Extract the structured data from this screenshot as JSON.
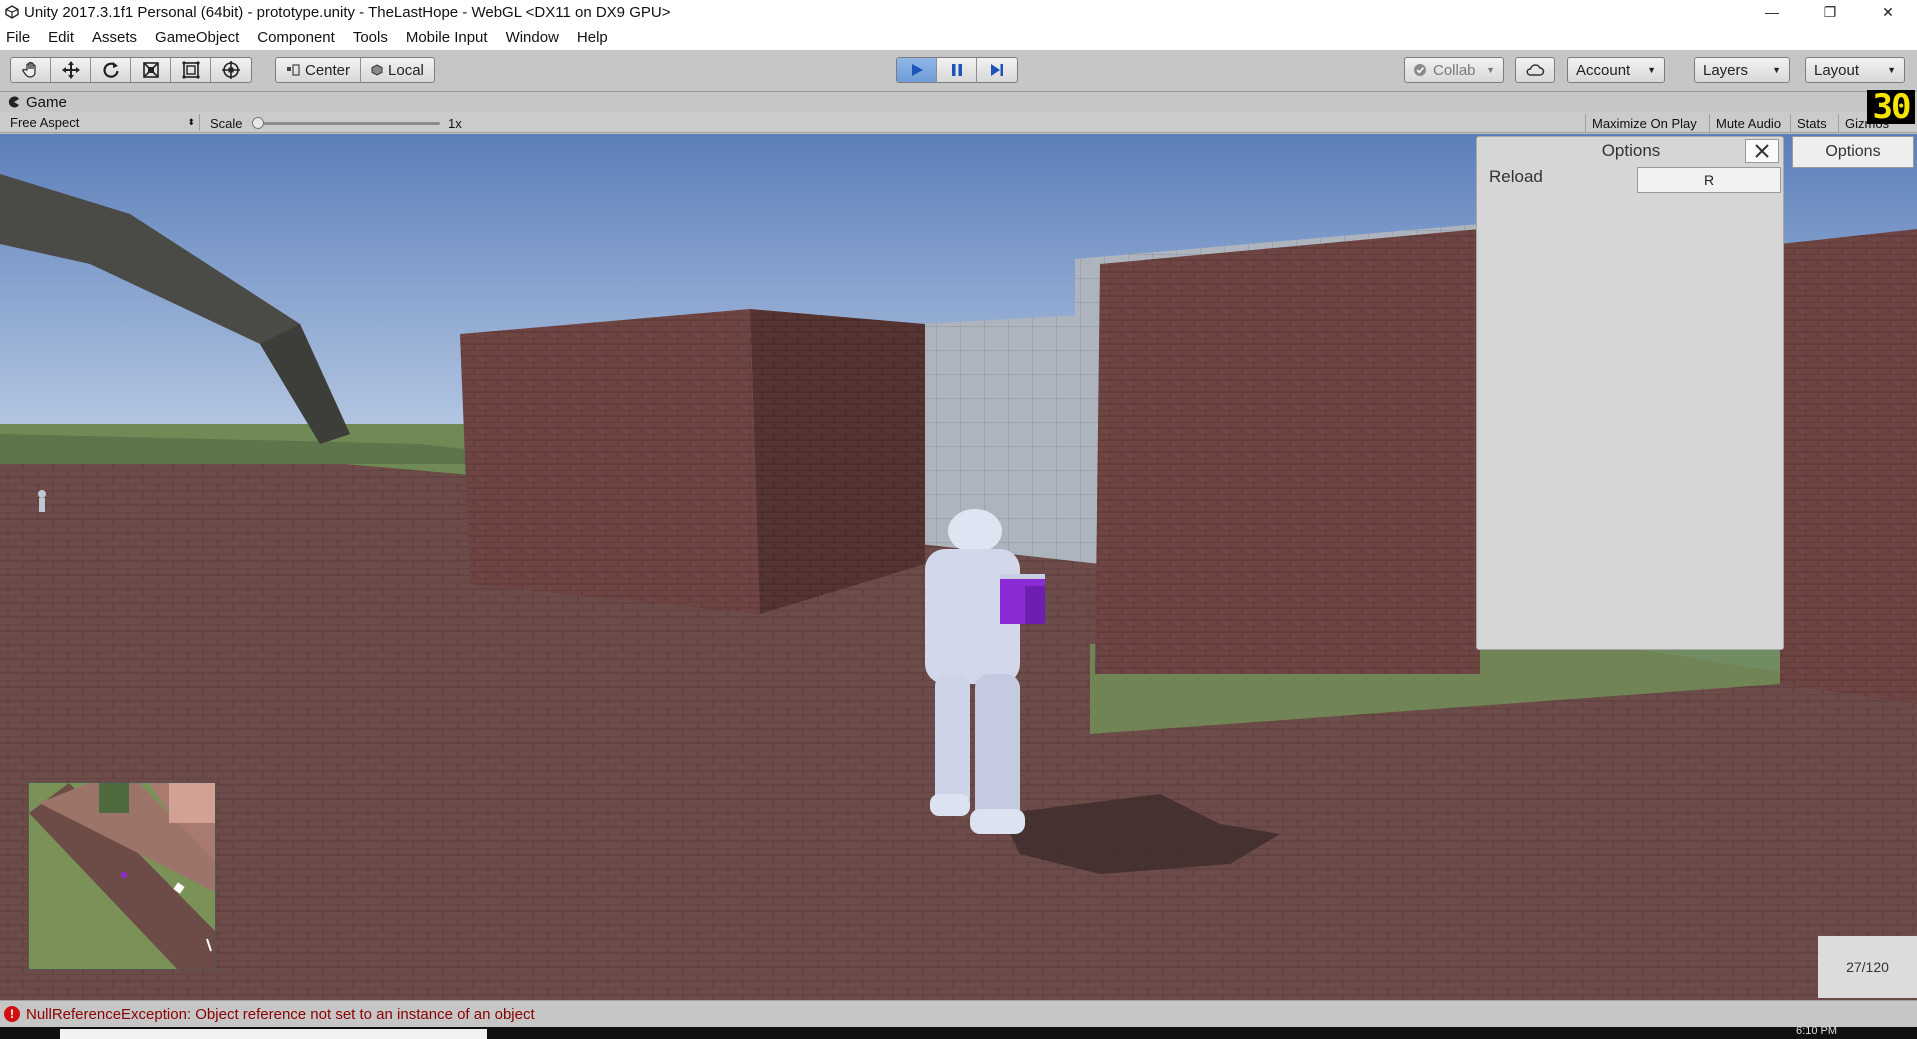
{
  "window": {
    "title": "Unity 2017.3.1f1 Personal (64bit) - prototype.unity - TheLastHope - WebGL <DX11 on DX9 GPU>",
    "minimize": "—",
    "maximize": "❐",
    "close": "✕"
  },
  "menu": [
    "File",
    "Edit",
    "Assets",
    "GameObject",
    "Component",
    "Tools",
    "Mobile Input",
    "Window",
    "Help"
  ],
  "toolbar": {
    "pivot_center": "Center",
    "pivot_local": "Local",
    "collab": "Collab",
    "account": "Account",
    "layers": "Layers",
    "layout": "Layout"
  },
  "game_tab": {
    "label": "Game"
  },
  "fps_counter": "30",
  "game_bar": {
    "aspect": "Free Aspect",
    "scale_label": "Scale",
    "scale_value": "1x",
    "scale_level": 0,
    "maximize_on_play": "Maximize On Play",
    "mute_audio": "Mute Audio",
    "stats": "Stats",
    "gizmos": "Gizmos"
  },
  "options_panel": {
    "title": "Options",
    "reload_label": "Reload",
    "reload_key": "R"
  },
  "options_button": "Options",
  "ammo": "27/120",
  "status": {
    "message": "NullReferenceException: Object reference not set to an instance of an object"
  },
  "taskbar": {
    "clock": "6:10 PM"
  },
  "colors": {
    "play_active": "#7aa6df",
    "error_red": "#d01010",
    "fps_yellow": "#f5e400",
    "sky": "#6b8bc0",
    "brick": "#6e4543",
    "grass": "#6f8a55"
  }
}
